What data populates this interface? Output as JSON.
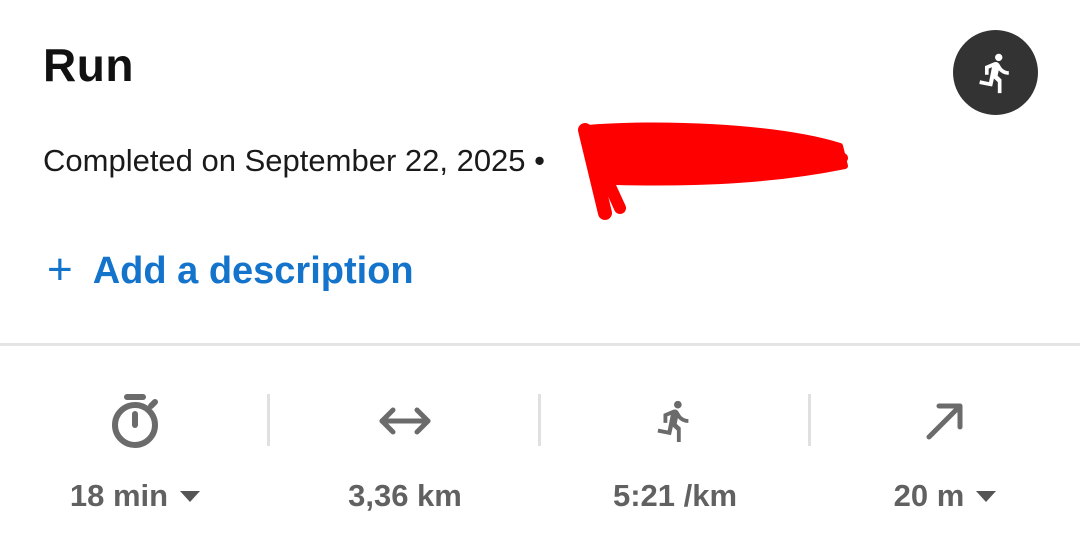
{
  "header": {
    "title": "Run",
    "activity_icon": "running-person-icon"
  },
  "summary": {
    "completed_text": "Completed on September 22, 2025 •"
  },
  "add_description": {
    "plus": "+",
    "label": "Add a description"
  },
  "stats": [
    {
      "icon": "stopwatch-icon",
      "value": "18 min",
      "has_dropdown": true
    },
    {
      "icon": "distance-arrows-icon",
      "value": "3,36 km",
      "has_dropdown": false
    },
    {
      "icon": "running-person-icon",
      "value": "5:21 /km",
      "has_dropdown": false
    },
    {
      "icon": "elevation-arrow-icon",
      "value": "20 m",
      "has_dropdown": true
    }
  ],
  "colors": {
    "accent": "#1474cc",
    "badge": "#333333",
    "icon_gray": "#6b6b6b",
    "redaction": "#ff0000"
  }
}
